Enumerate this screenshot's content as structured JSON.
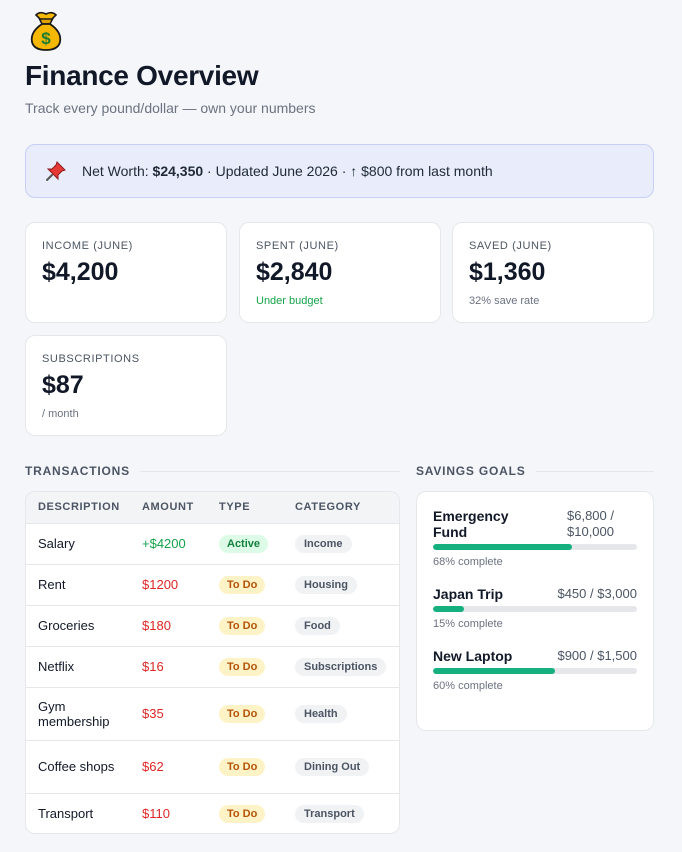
{
  "header": {
    "icon": "money-bag-icon",
    "title": "Finance Overview",
    "subtitle": "Track every pound/dollar — own your numbers"
  },
  "networth": {
    "icon": "pushpin-icon",
    "prefix": "Net Worth:",
    "value": "$24,350",
    "suffix": "· Updated June 2026 · ↑ $800 from last month"
  },
  "stats": [
    {
      "label": "Income (June)",
      "value": "$4,200",
      "note": ""
    },
    {
      "label": "Spent (June)",
      "value": "$2,840",
      "note": "Under budget"
    },
    {
      "label": "Saved (June)",
      "value": "$1,360",
      "note": "32% save rate"
    },
    {
      "label": "Subscriptions",
      "value": "$87",
      "note": "/ month"
    }
  ],
  "transactions": {
    "section_title": "TRANSACTIONS",
    "columns": [
      "DESCRIPTION",
      "AMOUNT",
      "TYPE",
      "CATEGORY"
    ],
    "rows": [
      {
        "description": "Salary",
        "amount": "+$4200",
        "type": "Active",
        "category": "Income"
      },
      {
        "description": "Rent",
        "amount": "$1200",
        "type": "To Do",
        "category": "Housing"
      },
      {
        "description": "Groceries",
        "amount": "$180",
        "type": "To Do",
        "category": "Food"
      },
      {
        "description": "Netflix",
        "amount": "$16",
        "type": "To Do",
        "category": "Subscriptions"
      },
      {
        "description": "Gym membership",
        "amount": "$35",
        "type": "To Do",
        "category": "Health"
      },
      {
        "description": "Coffee shops",
        "amount": "$62",
        "type": "To Do",
        "category": "Dining Out"
      },
      {
        "description": "Transport",
        "amount": "$110",
        "type": "To Do",
        "category": "Transport"
      }
    ]
  },
  "goals": {
    "section_title": "SAVINGS GOALS",
    "items": [
      {
        "name": "Emergency Fund",
        "amount": "$6,800 / $10,000",
        "progress": 0.68,
        "note": "68% complete"
      },
      {
        "name": "Japan Trip",
        "amount": "$450 / $3,000",
        "progress": 0.15,
        "note": "15% complete"
      },
      {
        "name": "New Laptop",
        "amount": "$900 / $1,500",
        "progress": 0.6,
        "note": "60% complete"
      }
    ]
  },
  "colors": {
    "accent_green": "#16b07e",
    "positive": "#16a34a",
    "negative": "#dc2626",
    "banner_bg": "#e8ecfb"
  }
}
